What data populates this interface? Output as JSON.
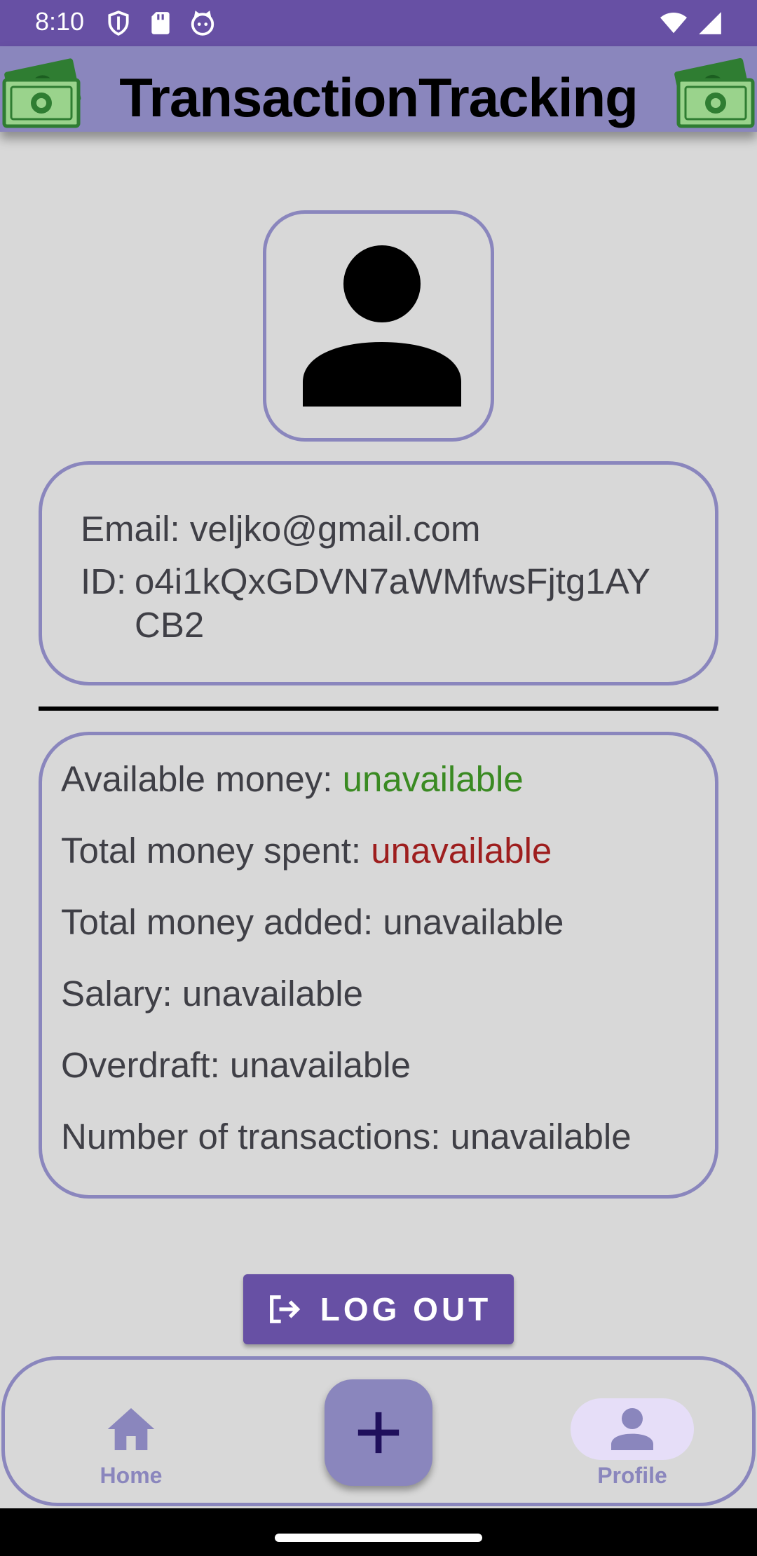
{
  "status_bar": {
    "time": "8:10",
    "background": "#6750a4",
    "left_icons": [
      "shield-icon",
      "sd-card-icon",
      "cat-icon"
    ],
    "right_icons": [
      "wifi-icon",
      "signal-icon"
    ]
  },
  "app_bar": {
    "title": "TransactionTracking",
    "background": "#8a86bd",
    "icons": [
      "money-icon",
      "money-icon"
    ]
  },
  "profile": {
    "avatar_icon": "person-icon",
    "email_label": "Email:",
    "email": "veljko@gmail.com",
    "id_label": "ID:",
    "id": "o4i1kQxGDVN7aWMfwsFjtg1AYCB2"
  },
  "stats": [
    {
      "label": "Available money:",
      "value": "unavailable",
      "value_color": "#3a8a22"
    },
    {
      "label": "Total money spent:",
      "value": "unavailable",
      "value_color": "#9e1e1e"
    },
    {
      "label": "Total money added:",
      "value": "unavailable"
    },
    {
      "label": "Salary:",
      "value": "unavailable"
    },
    {
      "label": "Overdraft:",
      "value": "unavailable"
    },
    {
      "label": "Number of transactions:",
      "value": "unavailable"
    }
  ],
  "logout": {
    "label": "LOG OUT",
    "icon": "logout-icon",
    "background": "#6750a4"
  },
  "bottom_nav": {
    "items": [
      {
        "label": "Home",
        "icon": "home-icon",
        "selected": false
      },
      {
        "label": "Profile",
        "icon": "person-icon",
        "selected": true
      }
    ],
    "fab_icon": "plus-icon",
    "accent": "#8a86bd",
    "selected_pill": "#e6def8"
  }
}
